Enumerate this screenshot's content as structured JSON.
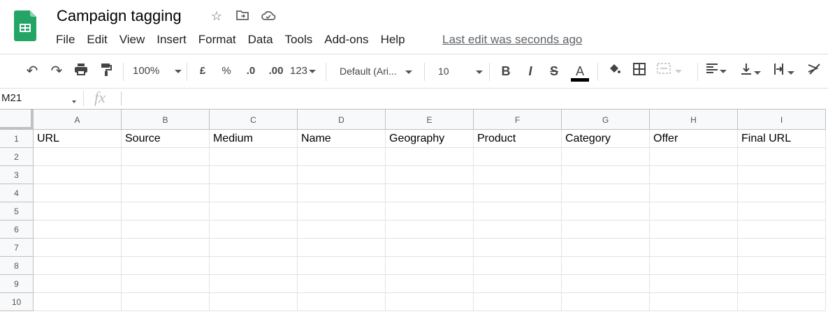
{
  "app": {
    "title": "Campaign tagging",
    "last_edit": "Last edit was seconds ago",
    "accent": "#0f9d58"
  },
  "menu": [
    "File",
    "Edit",
    "View",
    "Insert",
    "Format",
    "Data",
    "Tools",
    "Add-ons",
    "Help"
  ],
  "toolbar": {
    "zoom": "100%",
    "currency": "£",
    "percent": "%",
    "dec_decrease": ".0",
    "dec_increase": ".00",
    "more_formats": "123",
    "font": "Default (Ari...",
    "font_size": "10",
    "bold": "B",
    "italic": "I",
    "strike": "S",
    "text_color": "A",
    "text_color_value": "#000000"
  },
  "formula_bar": {
    "name_box": "M21",
    "fx": "fx",
    "value": ""
  },
  "columns": [
    "A",
    "B",
    "C",
    "D",
    "E",
    "F",
    "G",
    "H",
    "I"
  ],
  "rows": [
    [
      "URL",
      "Source",
      "Medium",
      "Name",
      "Geography",
      "Product",
      "Category",
      "Offer",
      "Final URL"
    ],
    [
      "",
      "",
      "",
      "",
      "",
      "",
      "",
      "",
      ""
    ],
    [
      "",
      "",
      "",
      "",
      "",
      "",
      "",
      "",
      ""
    ],
    [
      "",
      "",
      "",
      "",
      "",
      "",
      "",
      "",
      ""
    ],
    [
      "",
      "",
      "",
      "",
      "",
      "",
      "",
      "",
      ""
    ],
    [
      "",
      "",
      "",
      "",
      "",
      "",
      "",
      "",
      ""
    ],
    [
      "",
      "",
      "",
      "",
      "",
      "",
      "",
      "",
      ""
    ],
    [
      "",
      "",
      "",
      "",
      "",
      "",
      "",
      "",
      ""
    ],
    [
      "",
      "",
      "",
      "",
      "",
      "",
      "",
      "",
      ""
    ],
    [
      "",
      "",
      "",
      "",
      "",
      "",
      "",
      "",
      ""
    ]
  ],
  "row_numbers": [
    "1",
    "2",
    "3",
    "4",
    "5",
    "6",
    "7",
    "8",
    "9",
    "10"
  ]
}
